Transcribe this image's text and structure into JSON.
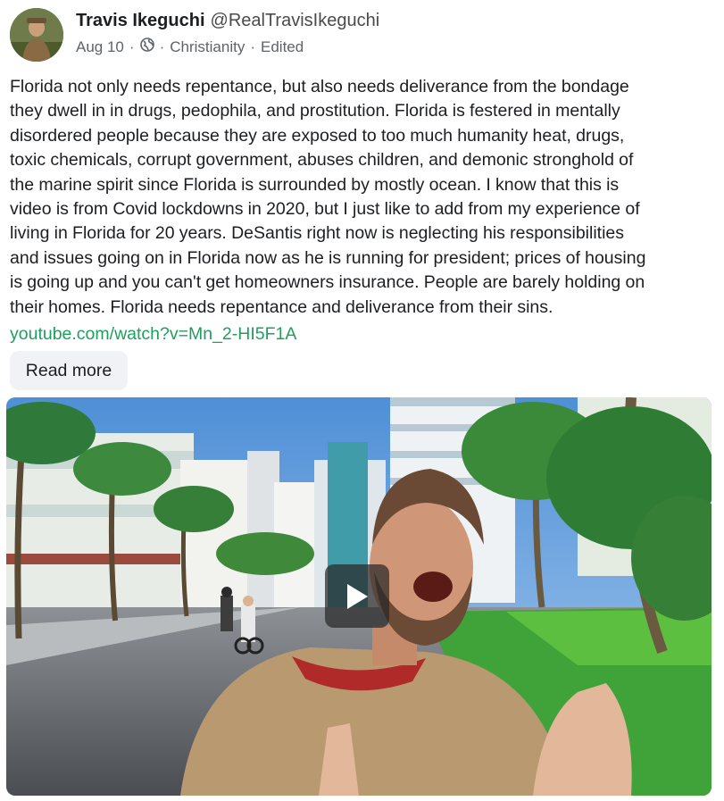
{
  "author": {
    "name": "Travis Ikeguchi",
    "handle": "@RealTravisIkeguchi"
  },
  "meta": {
    "date": "Aug 10",
    "separator": "·",
    "audience_icon": "globe-icon",
    "topic": "Christianity",
    "edited_label": "Edited"
  },
  "post": {
    "text": "Florida not only needs repentance, but also needs deliverance from the bondage\nthey dwell in in drugs, pedophila, and prostitution. Florida is festered in mentally\ndisordered people because they are exposed to too much humanity heat, drugs,\ntoxic chemicals, corrupt government, abuses children, and demonic stronghold of\nthe marine spirit since Florida is surrounded by mostly ocean. I know that this is\nvideo is from Covid lockdowns in 2020, but I just like to add from my experience of\nliving in Florida for 20 years. DeSantis right now is neglecting his responsibilities\nand issues going on in Florida now as he is running for president; prices of housing\nis going up and you can't get homeowners insurance. People are barely holding on\ntheir homes. Florida needs repentance and deliverance from their sins.",
    "link": "youtube.com/watch?v=Mn_2-HI5F1A",
    "read_more_label": "Read more"
  },
  "video": {
    "play_icon": "play-icon"
  },
  "colors": {
    "link": "#1f9e5f",
    "text": "#1c1e21",
    "meta": "#5f6368",
    "button_bg": "#f0f2f5"
  }
}
